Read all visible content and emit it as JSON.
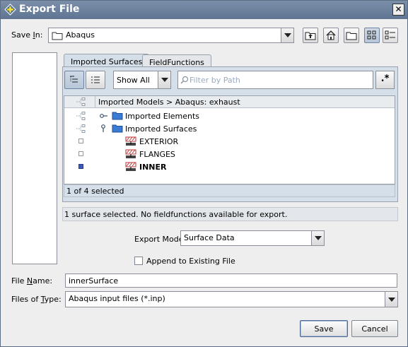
{
  "window": {
    "title": "Export File",
    "close_glyph": "✕"
  },
  "save_in": {
    "label_prefix": "Save ",
    "label_mnemonic": "I",
    "label_suffix": "n:",
    "value": "Abaqus",
    "toolbar_icons": [
      "up-folder-icon",
      "home-folder-icon",
      "new-folder-icon",
      "list-view-icon",
      "details-view-icon"
    ]
  },
  "tabs": [
    {
      "label": "Imported Surfaces",
      "active": true
    },
    {
      "label": "FieldFunctions",
      "active": false
    }
  ],
  "filter": {
    "show_value": "Show All",
    "placeholder": "Filter by Path",
    "regex_label": ".*"
  },
  "tree": {
    "header_path": "Imported Models > Abaqus: exhaust",
    "rows": [
      {
        "label": "Imported Elements",
        "kind": "folder",
        "selected": false
      },
      {
        "label": "Imported Surfaces",
        "kind": "folder",
        "selected": false
      },
      {
        "label": "EXTERIOR",
        "kind": "surface",
        "selected": false
      },
      {
        "label": "FLANGES",
        "kind": "surface",
        "selected": false
      },
      {
        "label": "INNER",
        "kind": "surface",
        "selected": true
      }
    ],
    "selection_status": "1 of 4 selected"
  },
  "info_message": "1 surface selected. No fieldfunctions available for export.",
  "export_mode": {
    "label": "Export Mode",
    "value": "Surface Data"
  },
  "append": {
    "label": "Append to Existing File",
    "checked": false
  },
  "file_name": {
    "label_mnemonic": "N",
    "label_prefix": "File ",
    "label_suffix": "ame:",
    "value": "innerSurface"
  },
  "files_of_type": {
    "label_prefix": "Files of ",
    "label_mnemonic": "T",
    "label_suffix": "ype:",
    "value": "Abaqus input files (*.inp)"
  },
  "buttons": {
    "save": "Save",
    "cancel": "Cancel"
  },
  "colors": {
    "accent": "#3d5bb5",
    "folder": "#3a7bd5",
    "titlebar": "#6a7f9b"
  }
}
